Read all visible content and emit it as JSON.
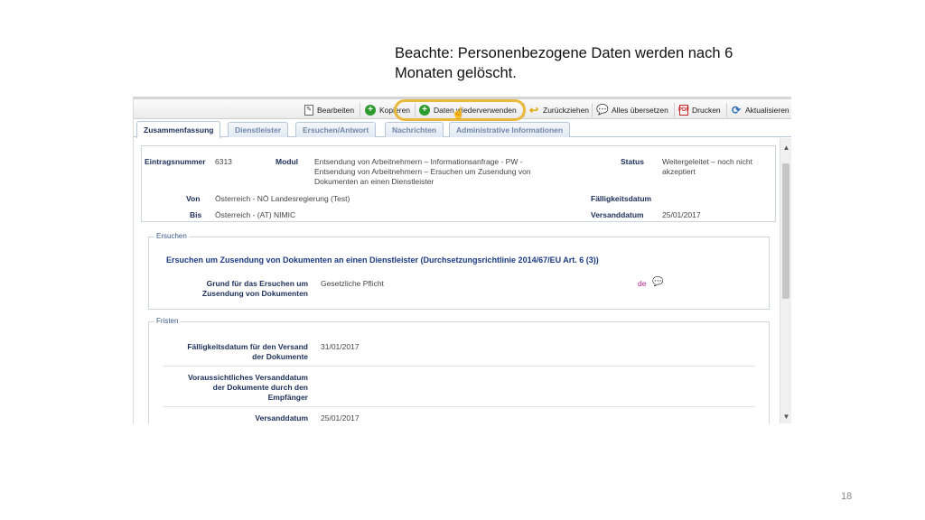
{
  "note": {
    "line1": "Beachte: Personenbezogene Daten werden nach 6",
    "line2": "Monaten gelöscht."
  },
  "slide_number": "18",
  "toolbar": {
    "edit": "Bearbeiten",
    "copy": "Kopieren",
    "reuse": "Daten wiederverwenden",
    "withdraw": "Zurückziehen",
    "translate_all": "Alles übersetzen",
    "print": "Drucken",
    "refresh": "Aktualisieren"
  },
  "tabs": [
    "Zusammenfassung",
    "Dienstleister",
    "Ersuchen/Antwort",
    "Nachrichten",
    "Administrative Informationen"
  ],
  "summary": {
    "entry_number_label": "Eintragsnummer",
    "entry_number_value": "6313",
    "module_label": "Modul",
    "module_value_1": "Entsendung von Arbeitnehmern – Informationsanfrage - PW -",
    "module_value_2": "Entsendung von Arbeitnehmern – Ersuchen um Zusendung von",
    "module_value_3": "Dokumenten an einen Dienstleister",
    "status_label": "Status",
    "status_value_1": "Weitergeleitet – noch nicht",
    "status_value_2": "akzeptiert",
    "from_label": "Von",
    "from_value": "Österreich - NÖ Landesregierung (Test)",
    "due_label": "Fälligkeitsdatum",
    "due_value": "",
    "to_label": "Bis",
    "to_value": "Österreich - (AT) NIMIC",
    "sent_label": "Versanddatum",
    "sent_value": "25/01/2017"
  },
  "request": {
    "legend": "Ersuchen",
    "title": "Ersuchen um Zusendung von Dokumenten an einen Dienstleister (Durchsetzungsrichtlinie 2014/67/EU Art. 6 (3))",
    "reason_label_1": "Grund für das Ersuchen um",
    "reason_label_2": "Zusendung von Dokumenten",
    "reason_value": "Gesetzliche Pflicht",
    "lang": "de"
  },
  "deadlines": {
    "legend": "Fristen",
    "due_label_1": "Fälligkeitsdatum für den Versand",
    "due_label_2": "der Dokumente",
    "due_value": "31/01/2017",
    "expected_label_1": "Voraussichtliches Versanddatum",
    "expected_label_2": "der Dokumente durch den",
    "expected_label_3": "Empfänger",
    "expected_value": "",
    "sent_label": "Versanddatum",
    "sent_value": "25/01/2017"
  },
  "colors": {
    "highlight": "#e9b93b",
    "label_blue": "#1b2e58",
    "language_magenta": "#b3268c"
  }
}
